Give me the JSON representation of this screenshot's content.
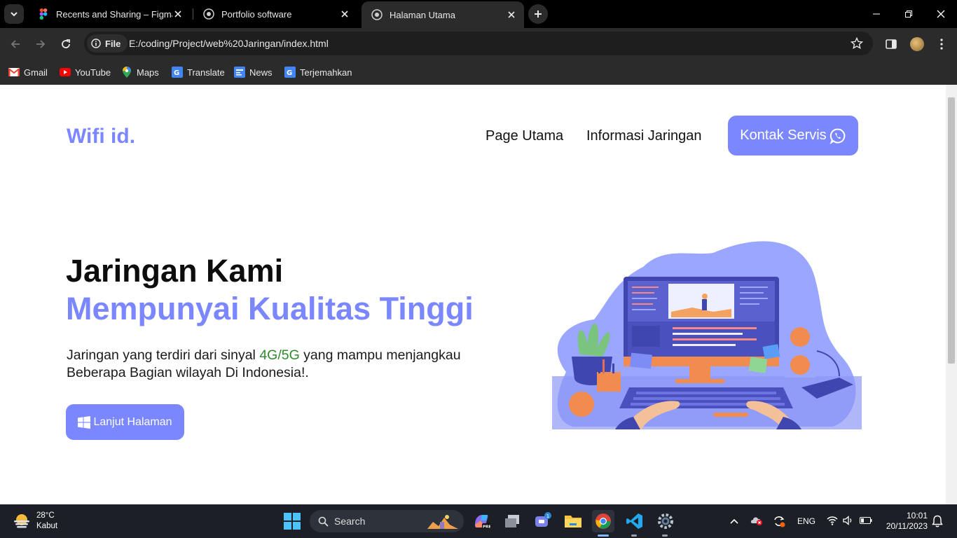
{
  "browser": {
    "tabs": [
      {
        "title": "Recents and Sharing – Figma",
        "favicon": "figma-icon",
        "active": false
      },
      {
        "title": "Portfolio software",
        "favicon": "globe-icon",
        "active": false
      },
      {
        "title": "Halaman Utama",
        "favicon": "globe-icon",
        "active": true
      }
    ],
    "site_chip": "File",
    "url": "E:/coding/Project/web%20Jaringan/index.html",
    "bookmarks": [
      {
        "label": "Gmail",
        "icon": "gmail-icon"
      },
      {
        "label": "YouTube",
        "icon": "youtube-icon"
      },
      {
        "label": "Maps",
        "icon": "maps-icon"
      },
      {
        "label": "Translate",
        "icon": "translate-icon"
      },
      {
        "label": "News",
        "icon": "news-icon"
      },
      {
        "label": "Terjemahkan",
        "icon": "translate-icon"
      }
    ]
  },
  "site": {
    "logo": "Wifi id.",
    "nav": [
      "Page Utama",
      "Informasi Jaringan"
    ],
    "cta_label": "Kontak Servis",
    "cta_icon": "whatsapp-icon",
    "hero": {
      "title_line1": "Jaringan Kami",
      "title_line2": "Mempunyai Kualitas Tinggi",
      "desc_before": "Jaringan yang terdiri dari sinyal ",
      "desc_highlight": "4G/5G",
      "desc_after": " yang mampu menjangkau Beberapa Bagian wilayah Di Indonesia!.",
      "button_label": "Lanjut Halaman",
      "button_icon": "windows-icon"
    },
    "colors": {
      "accent": "#7b87ff",
      "highlight": "#2e8b2e",
      "text": "#0d0d0d"
    }
  },
  "taskbar": {
    "weather_temp": "28°C",
    "weather_desc": "Kabut",
    "search_placeholder": "Search",
    "chat_badge": "1",
    "language": "ENG",
    "time": "10:01",
    "date": "20/11/2023"
  }
}
